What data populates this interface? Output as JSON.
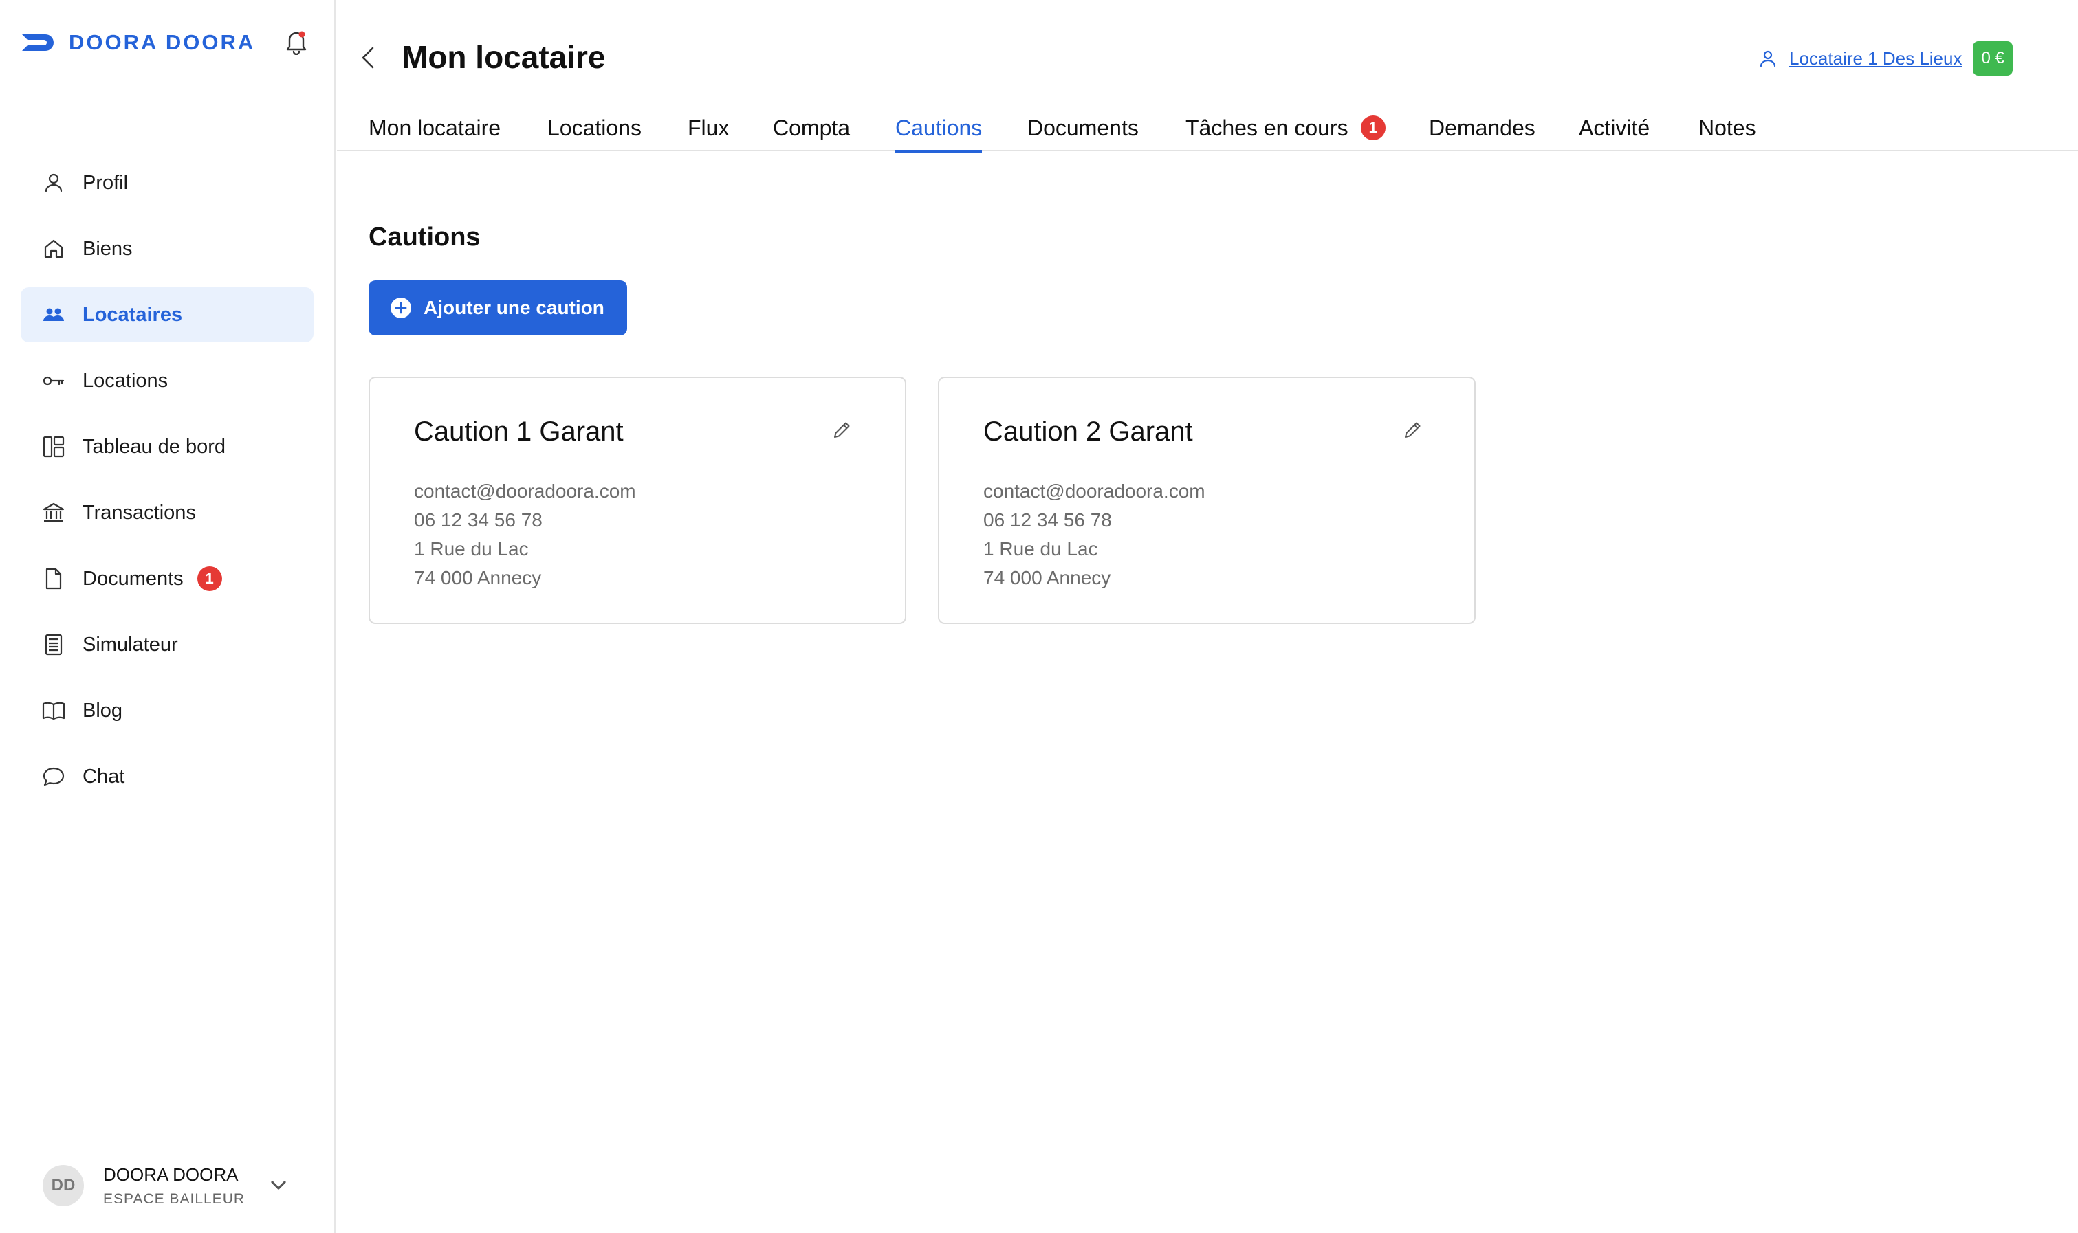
{
  "sidebar": {
    "brand": {
      "name": "DOORA DOORA",
      "logo_icon": "doora-logo-icon"
    },
    "notification_icon": "bell-icon",
    "items": [
      {
        "label": "Profil",
        "icon": "user-icon",
        "active": false
      },
      {
        "label": "Biens",
        "icon": "home-icon",
        "active": false
      },
      {
        "label": "Locataires",
        "icon": "users-icon",
        "active": true
      },
      {
        "label": "Locations",
        "icon": "key-icon",
        "active": false
      },
      {
        "label": "Tableau de bord",
        "icon": "dashboard-icon",
        "active": false
      },
      {
        "label": "Transactions",
        "icon": "bank-icon",
        "active": false
      },
      {
        "label": "Documents",
        "icon": "file-icon",
        "active": false,
        "badge": "1"
      },
      {
        "label": "Simulateur",
        "icon": "calculator-icon",
        "active": false
      },
      {
        "label": "Blog",
        "icon": "book-icon",
        "active": false
      },
      {
        "label": "Chat",
        "icon": "chat-icon",
        "active": false
      }
    ],
    "user": {
      "initials": "DD",
      "name": "DOORA DOORA",
      "role": "ESPACE BAILLEUR"
    }
  },
  "header": {
    "title": "Mon locataire",
    "tenant_link": "Locataire 1 Des Lieux",
    "balance": "0 €"
  },
  "tabs": [
    {
      "label": "Mon locataire",
      "active": false
    },
    {
      "label": "Locations",
      "active": false
    },
    {
      "label": "Flux",
      "active": false
    },
    {
      "label": "Compta",
      "active": false
    },
    {
      "label": "Cautions",
      "active": true
    },
    {
      "label": "Documents",
      "active": false
    },
    {
      "label": "Tâches en cours",
      "active": false,
      "badge": "1"
    },
    {
      "label": "Demandes",
      "active": false
    },
    {
      "label": "Activité",
      "active": false
    },
    {
      "label": "Notes",
      "active": false
    }
  ],
  "section": {
    "title": "Cautions",
    "add_button": "Ajouter une caution"
  },
  "cards": [
    {
      "title": "Caution 1 Garant",
      "email": "contact@dooradoora.com",
      "phone": "06 12 34 56 78",
      "street": "1 Rue du Lac",
      "city": "74 000 Annecy"
    },
    {
      "title": "Caution 2 Garant",
      "email": "contact@dooradoora.com",
      "phone": "06 12 34 56 78",
      "street": "1 Rue du Lac",
      "city": "74 000 Annecy"
    }
  ],
  "colors": {
    "accent": "#2563d9",
    "active_bg": "#e9f1fd",
    "badge": "#e53935",
    "balance": "#3fb950"
  }
}
